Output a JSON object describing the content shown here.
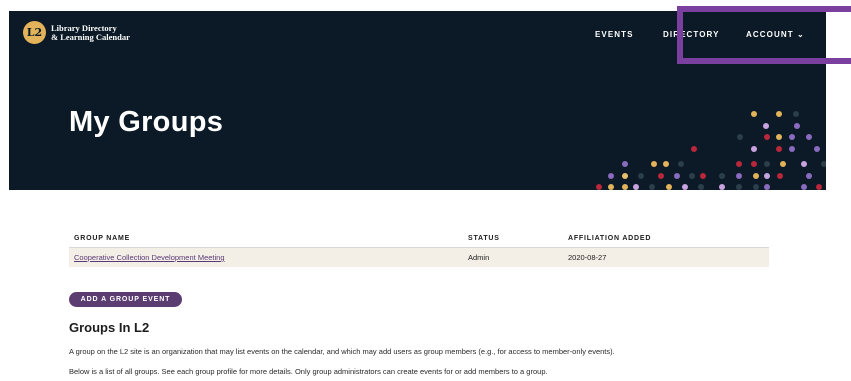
{
  "header": {
    "logo_badge": "L2",
    "logo_line1": "Library Directory",
    "logo_line2": "& Learning Calendar",
    "nav": [
      {
        "label": "EVENTS"
      },
      {
        "label": "DIRECTORY"
      },
      {
        "label": "ACCOUNT ⌄"
      }
    ],
    "title": "My Groups",
    "colors": {
      "background": "#0b1a26",
      "accent_gold": "#e2b35b",
      "highlight": "#7b3fa0"
    }
  },
  "table": {
    "headers": [
      "GROUP NAME",
      "STATUS",
      "AFFILIATION ADDED"
    ],
    "rows": [
      {
        "name": "Cooperative Collection Development Meeting",
        "status": "Admin",
        "added": "2020-08-27"
      }
    ]
  },
  "actions": {
    "add_event": "ADD A GROUP EVENT"
  },
  "section": {
    "title": "Groups In L2",
    "para1": "A group on the L2 site is an organization that may list events on the calendar, and which may add users as group members (e.g., for access to member-only events).",
    "para2": "Below is a list of all groups. See each group profile for more details. Only group administrators can create events for or add members to a group."
  }
}
